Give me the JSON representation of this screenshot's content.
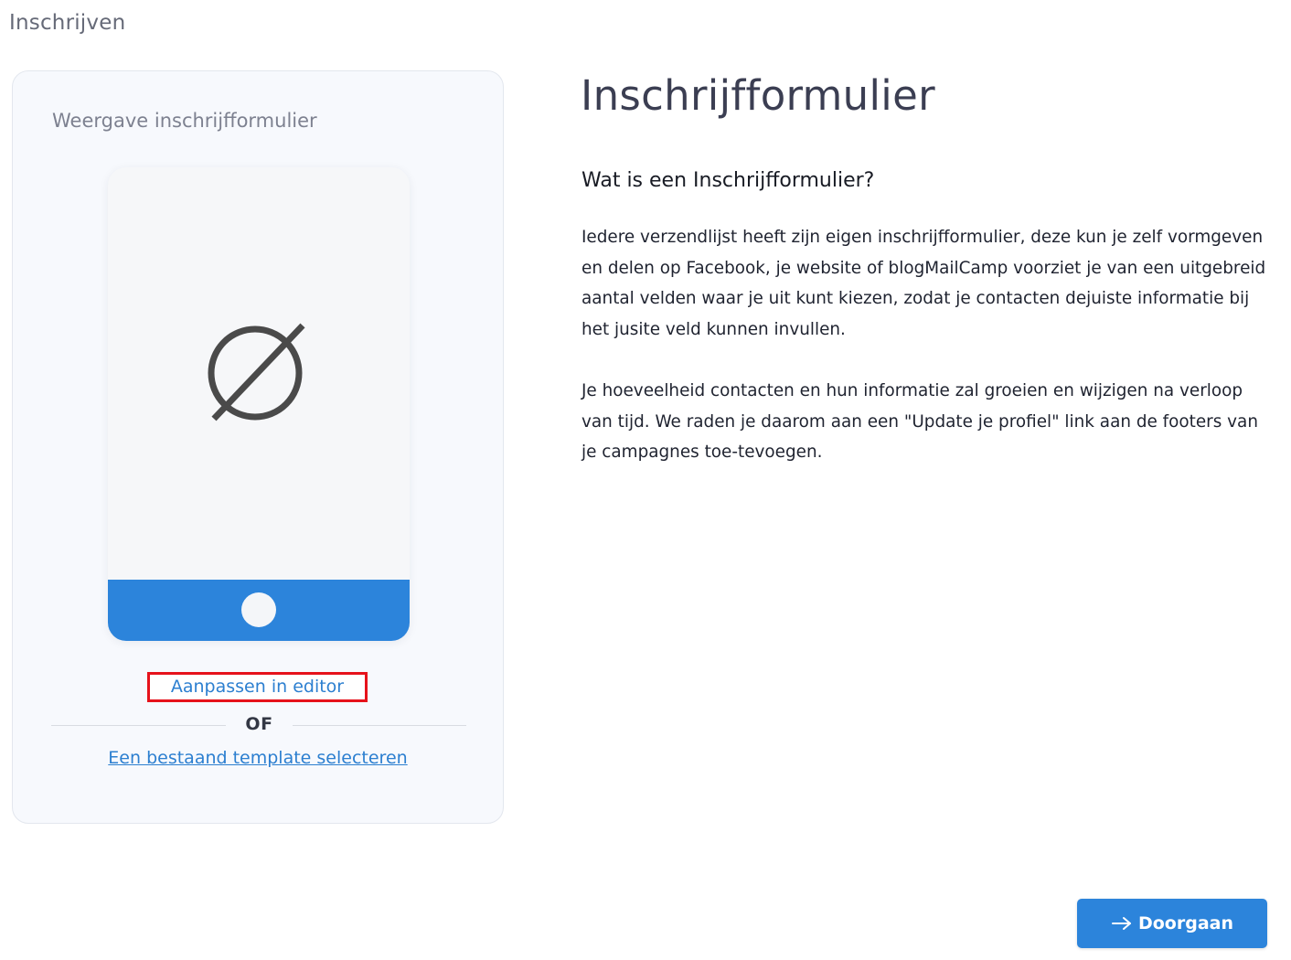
{
  "header": {
    "title": "Inschrijven"
  },
  "preview": {
    "title": "Weergave inschrijfformulier",
    "phone_icon": "empty-set-icon",
    "edit_link": "Aanpassen in editor",
    "divider": "OF",
    "template_link": "Een bestaand template selecteren"
  },
  "info": {
    "title": "Inschrijfformulier",
    "subtitle": "Wat is een Inschrijfformulier?",
    "paragraph1": "Iedere verzendlijst heeft zijn eigen inschrijfformulier, deze kun je zelf vormgeven en delen op Facebook, je website of blogMailCamp voorziet je van een uitgebreid aantal velden waar je uit kunt kiezen, zodat je contacten dejuiste informatie bij het jusite veld kunnen invullen.",
    "paragraph2": "Je hoeveelheid contacten en hun informatie zal groeien en wijzigen na verloop van tijd. We raden je daarom aan een \"Update je profiel\" link aan de footers van je campagnes toe-tevoegen."
  },
  "footer": {
    "continue_label": "Doorgaan",
    "continue_icon": "arrow-right-icon"
  },
  "colors": {
    "accent": "#2c84db",
    "link": "#2c7fd0",
    "highlight_border": "#e6121b"
  }
}
